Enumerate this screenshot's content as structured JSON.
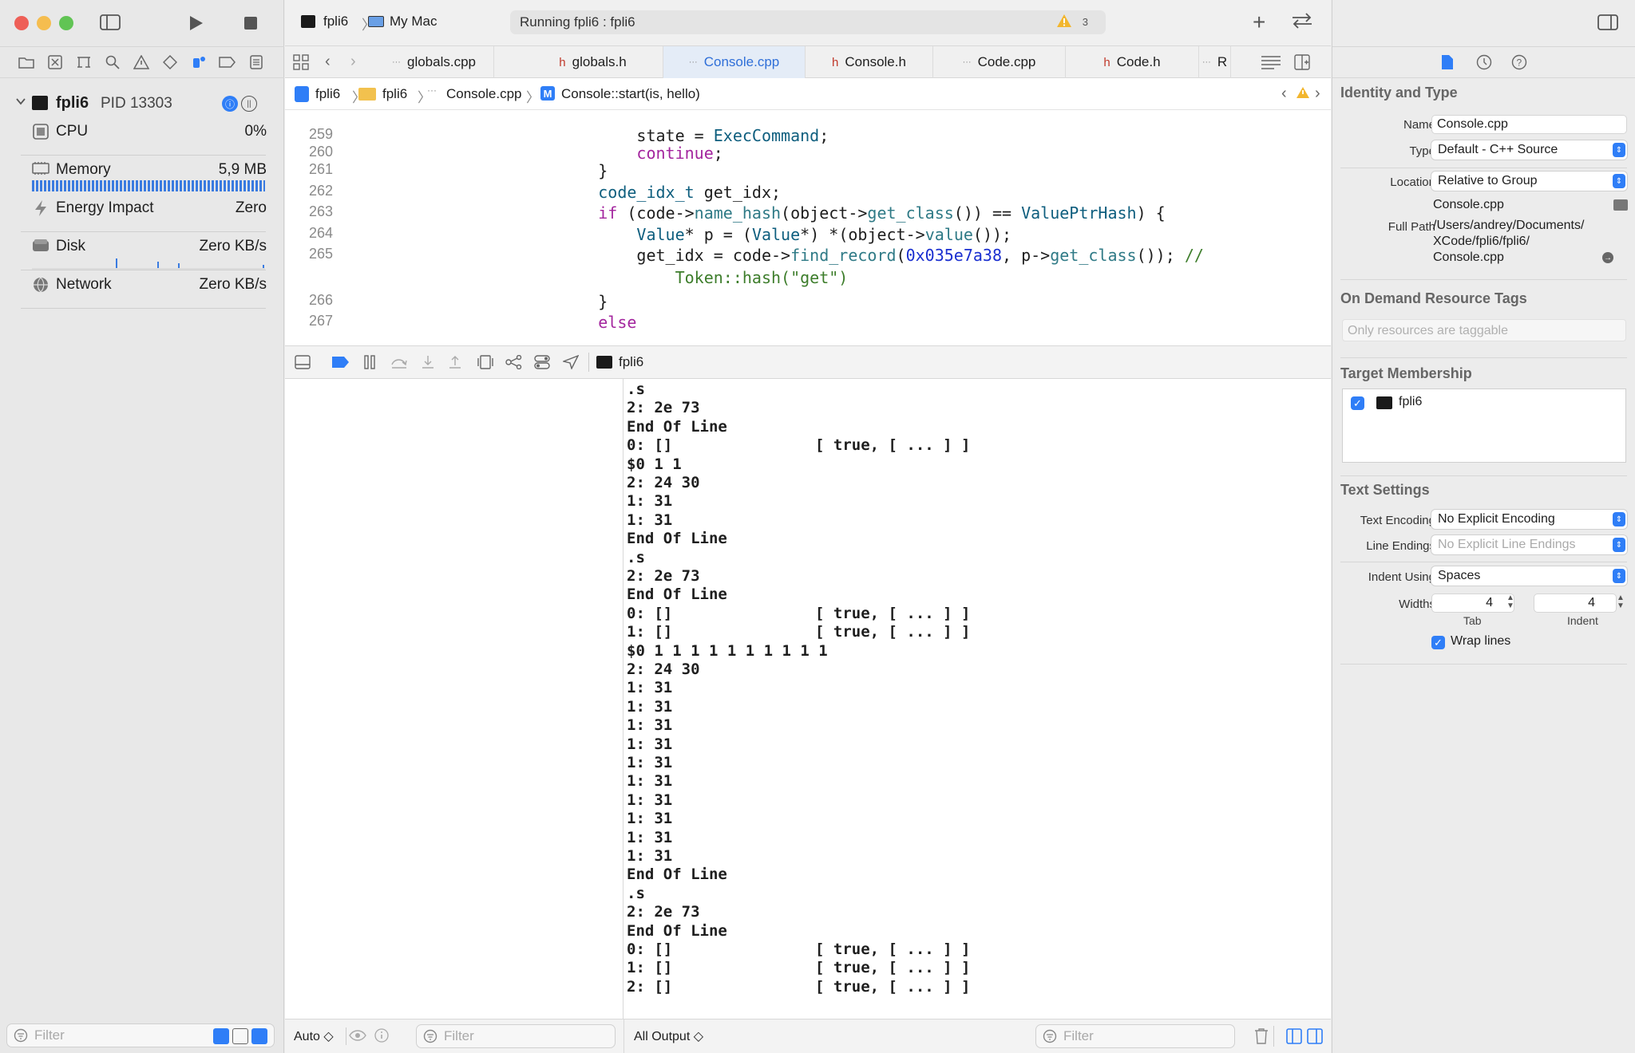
{
  "toolbar": {
    "scheme": "fpli6",
    "destination": "My Mac",
    "activity_status": "Running fpli6 : fpli6",
    "warning_count": "3"
  },
  "debug_navigator": {
    "process_name": "fpli6",
    "process_pid": "PID 13303",
    "gauges": [
      {
        "name": "CPU",
        "value": "0%"
      },
      {
        "name": "Memory",
        "value": "5,9 MB"
      },
      {
        "name": "Energy Impact",
        "value": "Zero"
      },
      {
        "name": "Disk",
        "value": "Zero KB/s"
      },
      {
        "name": "Network",
        "value": "Zero KB/s"
      }
    ],
    "filter_placeholder": "Filter"
  },
  "tabs": [
    {
      "label": "globals.cpp",
      "kind": "cpp"
    },
    {
      "label": "globals.h",
      "kind": "h"
    },
    {
      "label": "Console.cpp",
      "kind": "cpp"
    },
    {
      "label": "Console.h",
      "kind": "h"
    },
    {
      "label": "Code.cpp",
      "kind": "cpp"
    },
    {
      "label": "Code.h",
      "kind": "h"
    },
    {
      "label": "R",
      "kind": "cpp"
    }
  ],
  "jump_bar": {
    "project": "fpli6",
    "group": "fpli6",
    "file": "Console.cpp",
    "symbol": "Console::start(is, hello)"
  },
  "editor": {
    "lines": [
      {
        "n": "259",
        "html": "          state = <span class=\"ty\">ExecCommand</span>;"
      },
      {
        "n": "260",
        "html": "          <span class=\"kw\">continue</span>;"
      },
      {
        "n": "261",
        "html": "      }"
      },
      {
        "n": "262",
        "html": "      <span class=\"ty\">code_idx_t</span> get_idx;"
      },
      {
        "n": "263",
        "html": "      <span class=\"kw\">if</span> (code-><span class=\"fn\">name_hash</span>(object-><span class=\"fn\">get_class</span>()) == <span class=\"ty\">ValuePtrHash</span>) {"
      },
      {
        "n": "264",
        "html": "          <span class=\"ty\">Value</span>* p = (<span class=\"ty\">Value</span>*) *(object-><span class=\"fn\">value</span>());"
      },
      {
        "n": "265",
        "html": "          get_idx = code-><span class=\"fn\">find_record</span>(<span class=\"num\">0x035e7a38</span>, p-><span class=\"fn\">get_class</span>()); <span class=\"cm\">//</span>"
      },
      {
        "n": "",
        "html": "              <span class=\"cm\">Token::hash(\"get\")</span>"
      },
      {
        "n": "266",
        "html": "      }"
      },
      {
        "n": "267",
        "html": "      <span class=\"kw\">else</span>"
      }
    ]
  },
  "debug_bar": {
    "process": "fpli6"
  },
  "console": {
    "lines": [
      [
        ".s",
        ""
      ],
      [
        "2: 2e 73",
        ""
      ],
      [
        "End Of Line",
        ""
      ],
      [
        "0: []",
        "[ true, [ ... ] ]"
      ],
      [
        "$0 1 1",
        ""
      ],
      [
        "2: 24 30",
        ""
      ],
      [
        "1: 31",
        ""
      ],
      [
        "1: 31",
        ""
      ],
      [
        "End Of Line",
        ""
      ],
      [
        ".s",
        ""
      ],
      [
        "2: 2e 73",
        ""
      ],
      [
        "End Of Line",
        ""
      ],
      [
        "0: []",
        "[ true, [ ... ] ]"
      ],
      [
        "1: []",
        "[ true, [ ... ] ]"
      ],
      [
        "$0 1 1 1 1 1 1 1 1 1 1",
        ""
      ],
      [
        "2: 24 30",
        ""
      ],
      [
        "1: 31",
        ""
      ],
      [
        "1: 31",
        ""
      ],
      [
        "1: 31",
        ""
      ],
      [
        "1: 31",
        ""
      ],
      [
        "1: 31",
        ""
      ],
      [
        "1: 31",
        ""
      ],
      [
        "1: 31",
        ""
      ],
      [
        "1: 31",
        ""
      ],
      [
        "1: 31",
        ""
      ],
      [
        "1: 31",
        ""
      ],
      [
        "End Of Line",
        ""
      ],
      [
        ".s",
        ""
      ],
      [
        "2: 2e 73",
        ""
      ],
      [
        "End Of Line",
        ""
      ],
      [
        "0: []",
        "[ true, [ ... ] ]"
      ],
      [
        "1: []",
        "[ true, [ ... ] ]"
      ],
      [
        "2: []",
        "[ true, [ ... ] ]"
      ]
    ]
  },
  "bottom_bar": {
    "variables_scope": "Auto ◇",
    "variables_filter": "Filter",
    "output_mode": "All Output ◇",
    "console_filter": "Filter"
  },
  "inspector": {
    "identity_title": "Identity and Type",
    "name_label": "Name",
    "name_value": "Console.cpp",
    "type_label": "Type",
    "type_value": "Default - C++ Source",
    "location_label": "Location",
    "location_value": "Relative to Group",
    "location_file": "Console.cpp",
    "full_path_label": "Full Path",
    "full_path_line1": "/Users/andrey/Documents/",
    "full_path_line2": "XCode/fpli6/fpli6/",
    "full_path_line3": "Console.cpp",
    "odr_title": "On Demand Resource Tags",
    "odr_placeholder": "Only resources are taggable",
    "target_title": "Target Membership",
    "target_name": "fpli6",
    "text_title": "Text Settings",
    "encoding_label": "Text Encoding",
    "encoding_value": "No Explicit Encoding",
    "line_endings_label": "Line Endings",
    "line_endings_value": "No Explicit Line Endings",
    "indent_using_label": "Indent Using",
    "indent_using_value": "Spaces",
    "widths_label": "Widths",
    "tab_width": "4",
    "indent_width": "4",
    "tab_caption": "Tab",
    "indent_caption": "Indent",
    "wrap_label": "Wrap lines"
  },
  "colors": {
    "accent": "#2f7ef7",
    "close": "#ee5f57",
    "minimize": "#f5bd4f",
    "zoom": "#61c454",
    "memory_bar": "#3a7be0",
    "warning": "#f2b62e"
  }
}
